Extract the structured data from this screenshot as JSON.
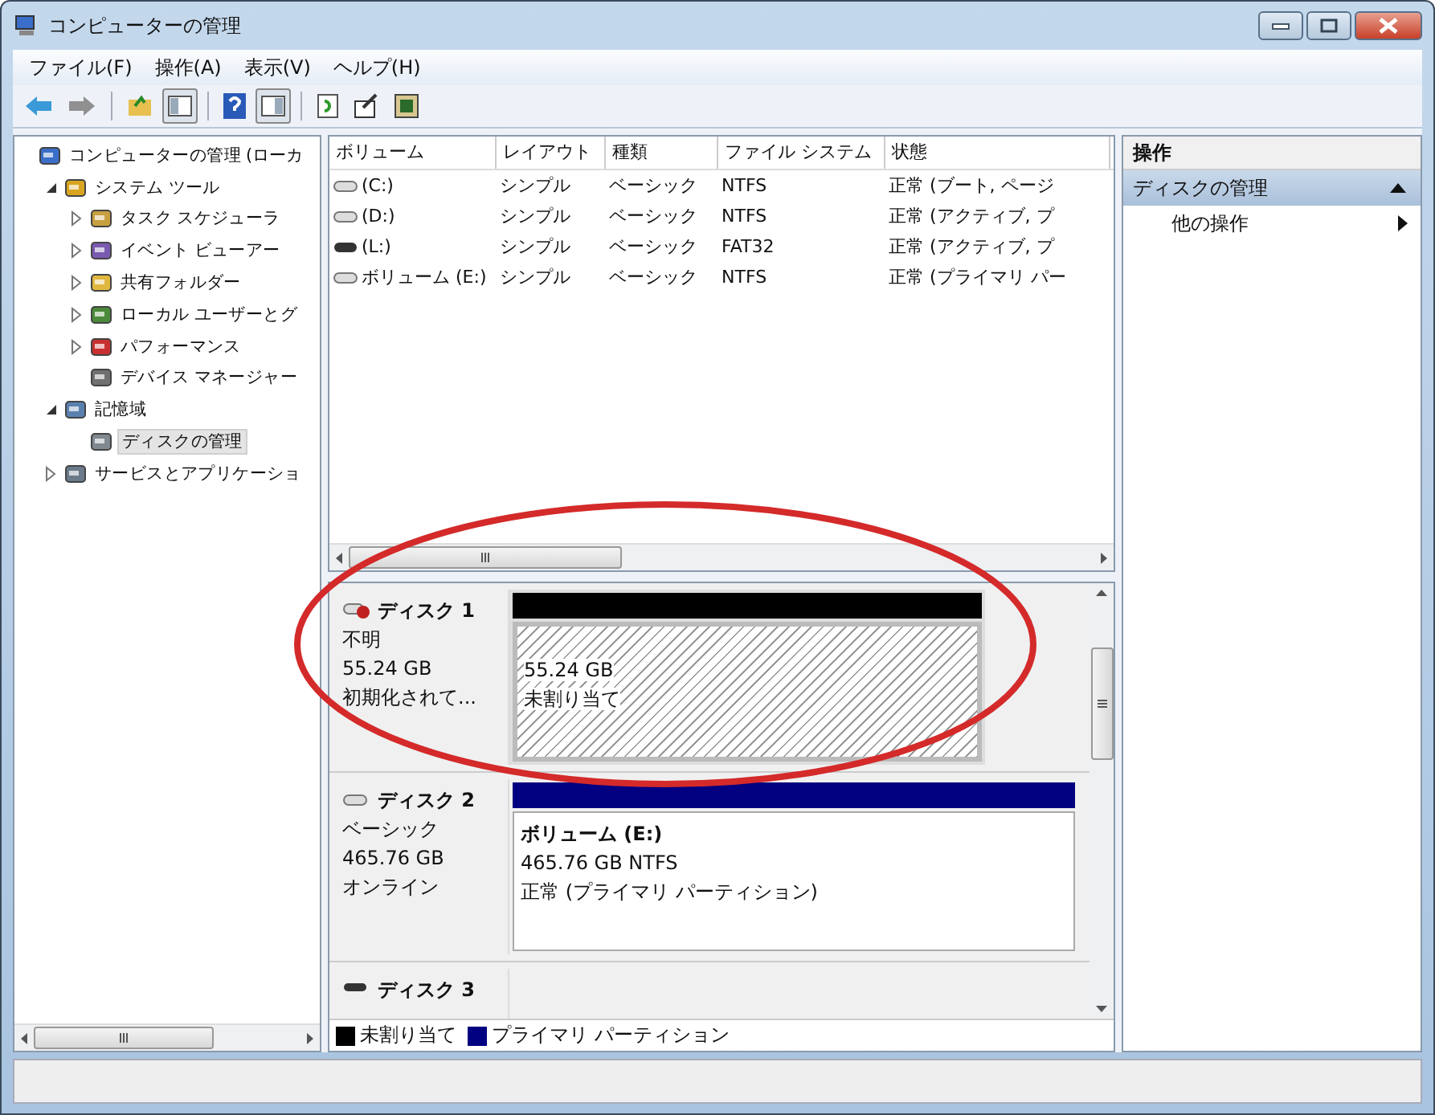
{
  "window": {
    "title": "コンピューターの管理"
  },
  "menu": [
    "ファイル(F)",
    "操作(A)",
    "表示(V)",
    "ヘルプ(H)"
  ],
  "tree": [
    {
      "label": "コンピューターの管理 (ローカ",
      "selected": false,
      "children": [
        {
          "label": "システム ツール",
          "expanded": true,
          "selected": false,
          "children": [
            {
              "label": "タスク スケジューラ",
              "expanded": false,
              "selected": false
            },
            {
              "label": "イベント ビューアー",
              "expanded": false,
              "selected": false
            },
            {
              "label": "共有フォルダー",
              "expanded": false,
              "selected": false
            },
            {
              "label": "ローカル ユーザーとグ",
              "expanded": false,
              "selected": false
            },
            {
              "label": "パフォーマンス",
              "expanded": false,
              "selected": false
            },
            {
              "label": "デバイス マネージャー",
              "selected": false
            }
          ]
        },
        {
          "label": "記憶域",
          "expanded": true,
          "selected": false,
          "children": [
            {
              "label": "ディスクの管理",
              "selected": true
            }
          ]
        },
        {
          "label": "サービスとアプリケーショ",
          "expanded": false,
          "selected": false
        }
      ]
    }
  ],
  "volumes": {
    "columns": [
      "ボリューム",
      "レイアウト",
      "種類",
      "ファイル システム",
      "状態"
    ],
    "rows": [
      {
        "kind": "fixed",
        "cells": [
          "(C:)",
          "シンプル",
          "ベーシック",
          "NTFS",
          "正常 (ブート, ページ"
        ]
      },
      {
        "kind": "fixed",
        "cells": [
          "(D:)",
          "シンプル",
          "ベーシック",
          "NTFS",
          "正常 (アクティブ, プ"
        ]
      },
      {
        "kind": "removable",
        "cells": [
          "(L:)",
          "シンプル",
          "ベーシック",
          "FAT32",
          "正常 (アクティブ, プ"
        ]
      },
      {
        "kind": "fixed",
        "cells": [
          "ボリューム (E:)",
          "シンプル",
          "ベーシック",
          "NTFS",
          "正常 (プライマリ パー"
        ]
      }
    ]
  },
  "disks": [
    {
      "kind": "unknown",
      "name": "ディスク 1",
      "lines": [
        "不明",
        "55.24 GB",
        "初期化されて..."
      ],
      "partitions": [
        {
          "kind": "unallocated",
          "color": "#000000",
          "lines": [
            "55.24 GB",
            "未割り当て"
          ]
        }
      ]
    },
    {
      "kind": "basic",
      "name": "ディスク 2",
      "lines": [
        "ベーシック",
        "465.76 GB",
        "オンライン"
      ],
      "partitions": [
        {
          "kind": "primary",
          "color": "#000080",
          "title": "ボリューム (E:)",
          "lines": [
            "465.76 GB NTFS",
            "正常 (プライマリ パーティション)"
          ]
        }
      ]
    },
    {
      "kind": "removable",
      "name": "ディスク 3"
    }
  ],
  "legend": [
    {
      "color": "#000000",
      "label": "未割り当て"
    },
    {
      "color": "#000080",
      "label": "プライマリ パーティション"
    }
  ],
  "actions": {
    "header": "操作",
    "sections": [
      {
        "label": "ディスクの管理",
        "expanded": true,
        "items": [
          "他の操作"
        ]
      }
    ]
  },
  "highlight": {
    "kind": "ellipse",
    "color": "#d42a2a"
  }
}
